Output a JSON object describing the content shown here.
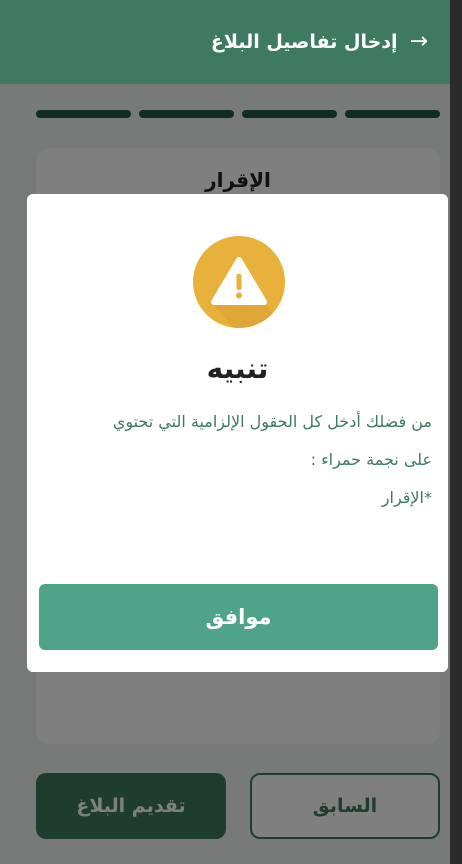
{
  "header": {
    "title": "إدخال تفاصيل البلاغ",
    "back_icon": "arrow-right-icon"
  },
  "stepper": {
    "total_steps": 4,
    "completed_steps": 4
  },
  "card": {
    "title": "الإقرار"
  },
  "footer": {
    "submit_label": "تقديم البلاغ",
    "previous_label": "السابق"
  },
  "dialog": {
    "icon": "warning-icon",
    "title": "تنبيه",
    "message_line1": "من فضلك أدخل كل الحقول الإلزامية التي تحتوي",
    "message_line2": "على نجمة حمراء :",
    "missing_field": "*الإقرار",
    "ok_label": "موافق"
  },
  "colors": {
    "primary": "#3e7a5f",
    "ok_button": "#4fa388",
    "warning": "#e8b13c"
  }
}
